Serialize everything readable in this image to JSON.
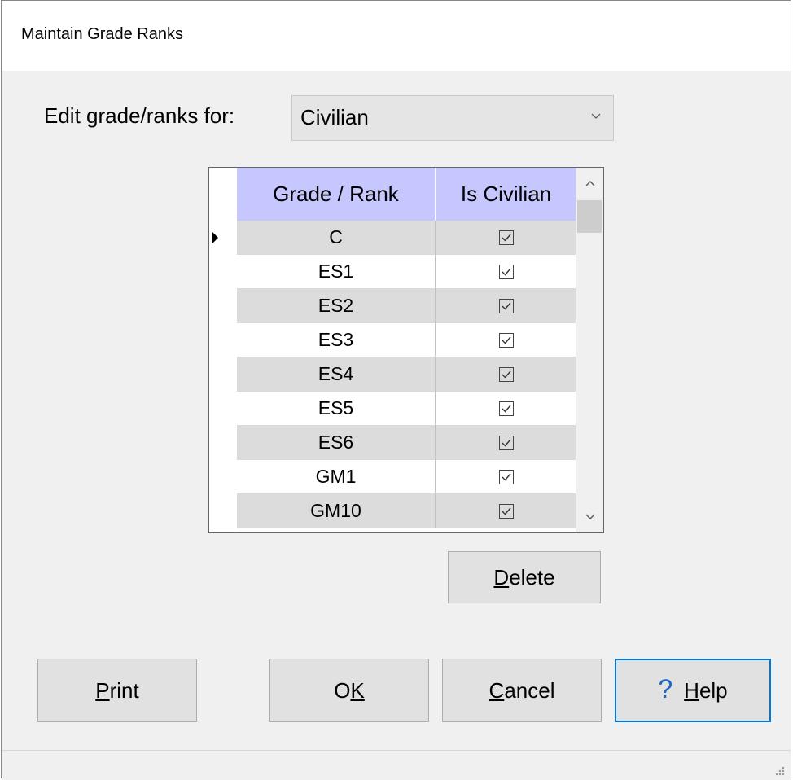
{
  "window": {
    "title": "Maintain Grade Ranks"
  },
  "filter": {
    "label": "Edit grade/ranks for:",
    "selected": "Civilian"
  },
  "grid": {
    "columns": [
      "Grade / Rank",
      "Is Civilian"
    ],
    "rows": [
      {
        "grade": "C",
        "civilian": true,
        "current": true
      },
      {
        "grade": "ES1",
        "civilian": true
      },
      {
        "grade": "ES2",
        "civilian": true
      },
      {
        "grade": "ES3",
        "civilian": true
      },
      {
        "grade": "ES4",
        "civilian": true
      },
      {
        "grade": "ES5",
        "civilian": true
      },
      {
        "grade": "ES6",
        "civilian": true
      },
      {
        "grade": "GM1",
        "civilian": true
      },
      {
        "grade": "GM10",
        "civilian": true
      }
    ]
  },
  "buttons": {
    "delete_mnemonic": "D",
    "delete_rest": "elete",
    "print_mnemonic": "P",
    "print_rest": "rint",
    "ok_prefix": "O",
    "ok_mnemonic": "K",
    "cancel_mnemonic": "C",
    "cancel_rest": "ancel",
    "help_icon": "?",
    "help_mnemonic": "H",
    "help_rest": "elp"
  },
  "colors": {
    "header_bg": "#c7c7ff",
    "alt_row_bg": "#dcdcdc",
    "focus_border": "#0078d7",
    "help_icon": "#1e66c8"
  }
}
